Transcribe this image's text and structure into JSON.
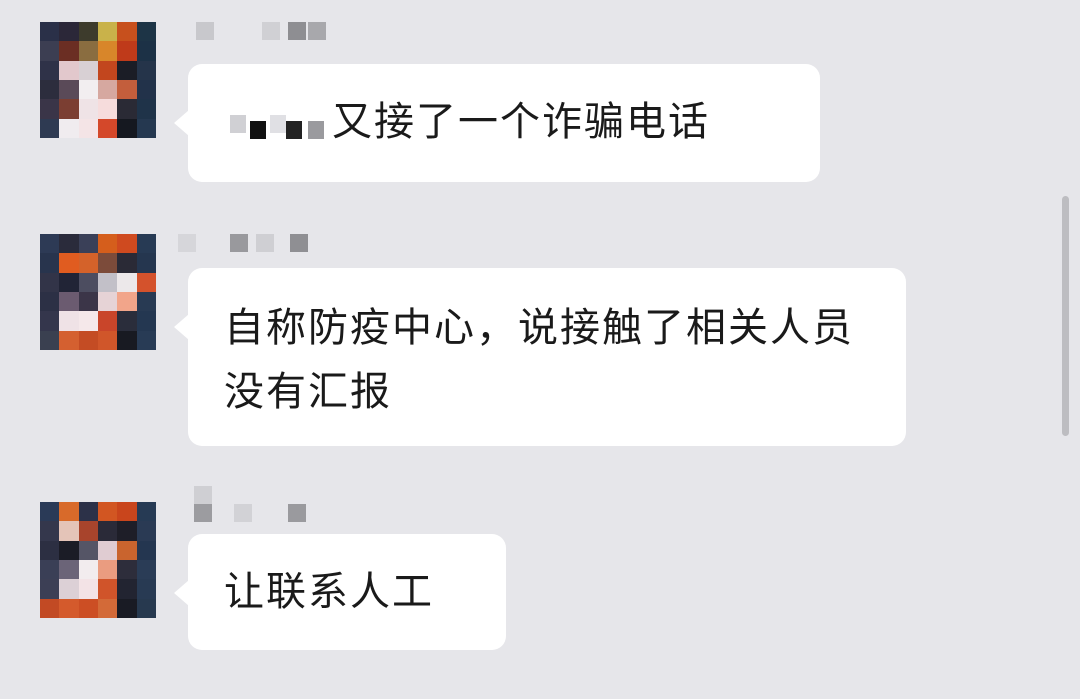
{
  "messages": [
    {
      "sender_name": "",
      "text": "又接了一个诈骗电话",
      "text_prefix_censored": true
    },
    {
      "sender_name": "",
      "text": "自称防疫中心，说接触了相关人员没有汇报",
      "text_prefix_censored": false
    },
    {
      "sender_name": "",
      "text": "让联系人工",
      "text_prefix_censored": false
    }
  ],
  "colors": {
    "background": "#e6e6ea",
    "bubble": "#ffffff",
    "text": "#1a1a1a",
    "scrollbar": "#bdbdc1"
  },
  "icons": {
    "avatar": "pixelated-avatar",
    "sender_name": "pixelated-name",
    "censor": "pixelated-censor"
  }
}
